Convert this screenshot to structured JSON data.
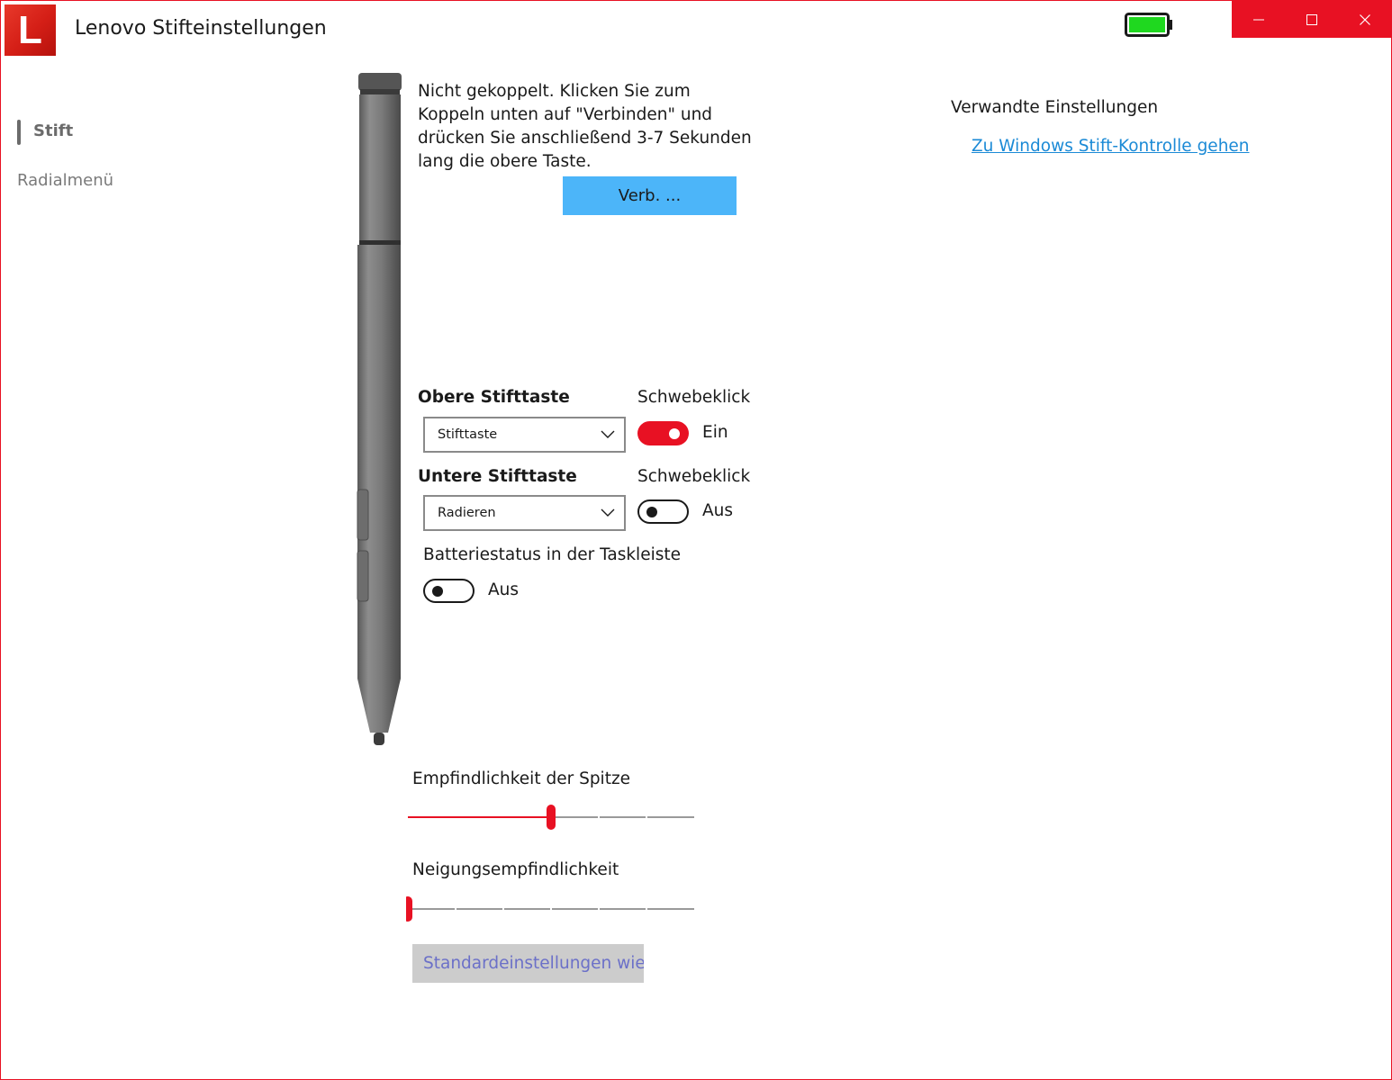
{
  "window": {
    "title": "Lenovo Stifteinstellungen",
    "logo_letter": "L",
    "battery_level": 1.0,
    "battery_color": "#1fd81f",
    "controls": [
      {
        "name": "minimize",
        "icon": "minimize-icon"
      },
      {
        "name": "maximize",
        "icon": "maximize-icon"
      },
      {
        "name": "close",
        "icon": "close-icon"
      }
    ],
    "accent_color": "#e81123"
  },
  "nav": {
    "items": [
      {
        "label": "Stift",
        "active": true
      },
      {
        "label": "Radialmenü",
        "active": false
      }
    ]
  },
  "pairing": {
    "message": "Nicht gekoppelt. Klicken Sie zum Koppeln unten auf \"Verbinden\" und drücken Sie anschließend 3-7 Sekunden lang die obere Taste.",
    "connect_label": "Verb. ..."
  },
  "related": {
    "title": "Verwandte Einstellungen",
    "link": "Zu Windows Stift-Kontrolle gehen"
  },
  "buttons": {
    "upper": {
      "label": "Obere Stifttaste",
      "value": "Stifttaste",
      "hover_label": "Schwebeklick",
      "hover_on": true,
      "hover_state": "Ein"
    },
    "lower": {
      "label": "Untere Stifttaste",
      "value": "Radieren",
      "hover_label": "Schwebeklick",
      "hover_on": false,
      "hover_state": "Aus"
    }
  },
  "battery_taskbar": {
    "label": "Batteriestatus in der Taskleiste",
    "on": false,
    "state": "Aus"
  },
  "tip_sensitivity": {
    "label": "Empfindlichkeit der Spitze",
    "value": 0.5
  },
  "tilt_sensitivity": {
    "label": "Neigungsempfindlichkeit",
    "value": 0.0
  },
  "reset": {
    "label": "Standardeinstellungen wiederherstellen"
  }
}
